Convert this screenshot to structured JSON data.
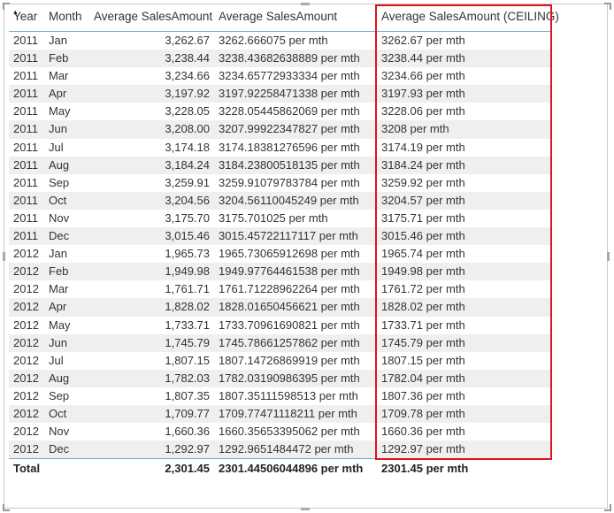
{
  "columns": [
    "Year",
    "Month",
    "Average SalesAmount",
    "Average SalesAmount",
    "Average SalesAmount (CEILING)"
  ],
  "sort_indicator": "▲",
  "rows": [
    [
      "2011",
      "Jan",
      "3,262.67",
      "3262.666075 per mth",
      "3262.67 per mth"
    ],
    [
      "2011",
      "Feb",
      "3,238.44",
      "3238.43682638889 per mth",
      "3238.44 per mth"
    ],
    [
      "2011",
      "Mar",
      "3,234.66",
      "3234.65772933334 per mth",
      "3234.66 per mth"
    ],
    [
      "2011",
      "Apr",
      "3,197.92",
      "3197.92258471338 per mth",
      "3197.93 per mth"
    ],
    [
      "2011",
      "May",
      "3,228.05",
      "3228.05445862069 per mth",
      "3228.06 per mth"
    ],
    [
      "2011",
      "Jun",
      "3,208.00",
      "3207.99922347827 per mth",
      "3208 per mth"
    ],
    [
      "2011",
      "Jul",
      "3,174.18",
      "3174.18381276596 per mth",
      "3174.19 per mth"
    ],
    [
      "2011",
      "Aug",
      "3,184.24",
      "3184.23800518135 per mth",
      "3184.24 per mth"
    ],
    [
      "2011",
      "Sep",
      "3,259.91",
      "3259.91079783784 per mth",
      "3259.92 per mth"
    ],
    [
      "2011",
      "Oct",
      "3,204.56",
      "3204.56110045249 per mth",
      "3204.57 per mth"
    ],
    [
      "2011",
      "Nov",
      "3,175.70",
      "3175.701025 per mth",
      "3175.71 per mth"
    ],
    [
      "2011",
      "Dec",
      "3,015.46",
      "3015.45722117117 per mth",
      "3015.46 per mth"
    ],
    [
      "2012",
      "Jan",
      "1,965.73",
      "1965.73065912698 per mth",
      "1965.74 per mth"
    ],
    [
      "2012",
      "Feb",
      "1,949.98",
      "1949.97764461538 per mth",
      "1949.98 per mth"
    ],
    [
      "2012",
      "Mar",
      "1,761.71",
      "1761.71228962264 per mth",
      "1761.72 per mth"
    ],
    [
      "2012",
      "Apr",
      "1,828.02",
      "1828.01650456621 per mth",
      "1828.02 per mth"
    ],
    [
      "2012",
      "May",
      "1,733.71",
      "1733.70961690821 per mth",
      "1733.71 per mth"
    ],
    [
      "2012",
      "Jun",
      "1,745.79",
      "1745.78661257862 per mth",
      "1745.79 per mth"
    ],
    [
      "2012",
      "Jul",
      "1,807.15",
      "1807.14726869919 per mth",
      "1807.15 per mth"
    ],
    [
      "2012",
      "Aug",
      "1,782.03",
      "1782.03190986395 per mth",
      "1782.04 per mth"
    ],
    [
      "2012",
      "Sep",
      "1,807.35",
      "1807.35111598513 per mth",
      "1807.36 per mth"
    ],
    [
      "2012",
      "Oct",
      "1,709.77",
      "1709.77471118211 per mth",
      "1709.78 per mth"
    ],
    [
      "2012",
      "Nov",
      "1,660.36",
      "1660.35653395062 per mth",
      "1660.36 per mth"
    ],
    [
      "2012",
      "Dec",
      "1,292.97",
      "1292.9651484472 per mth",
      "1292.97 per mth"
    ]
  ],
  "total": {
    "label": "Total",
    "avg": "2,301.45",
    "avg_raw": "2301.44506044896 per mth",
    "ceiling": "2301.45 per mth"
  },
  "colors": {
    "highlight": "#e0141e",
    "accent_line": "#6aaed6",
    "stripe": "#efefef"
  }
}
